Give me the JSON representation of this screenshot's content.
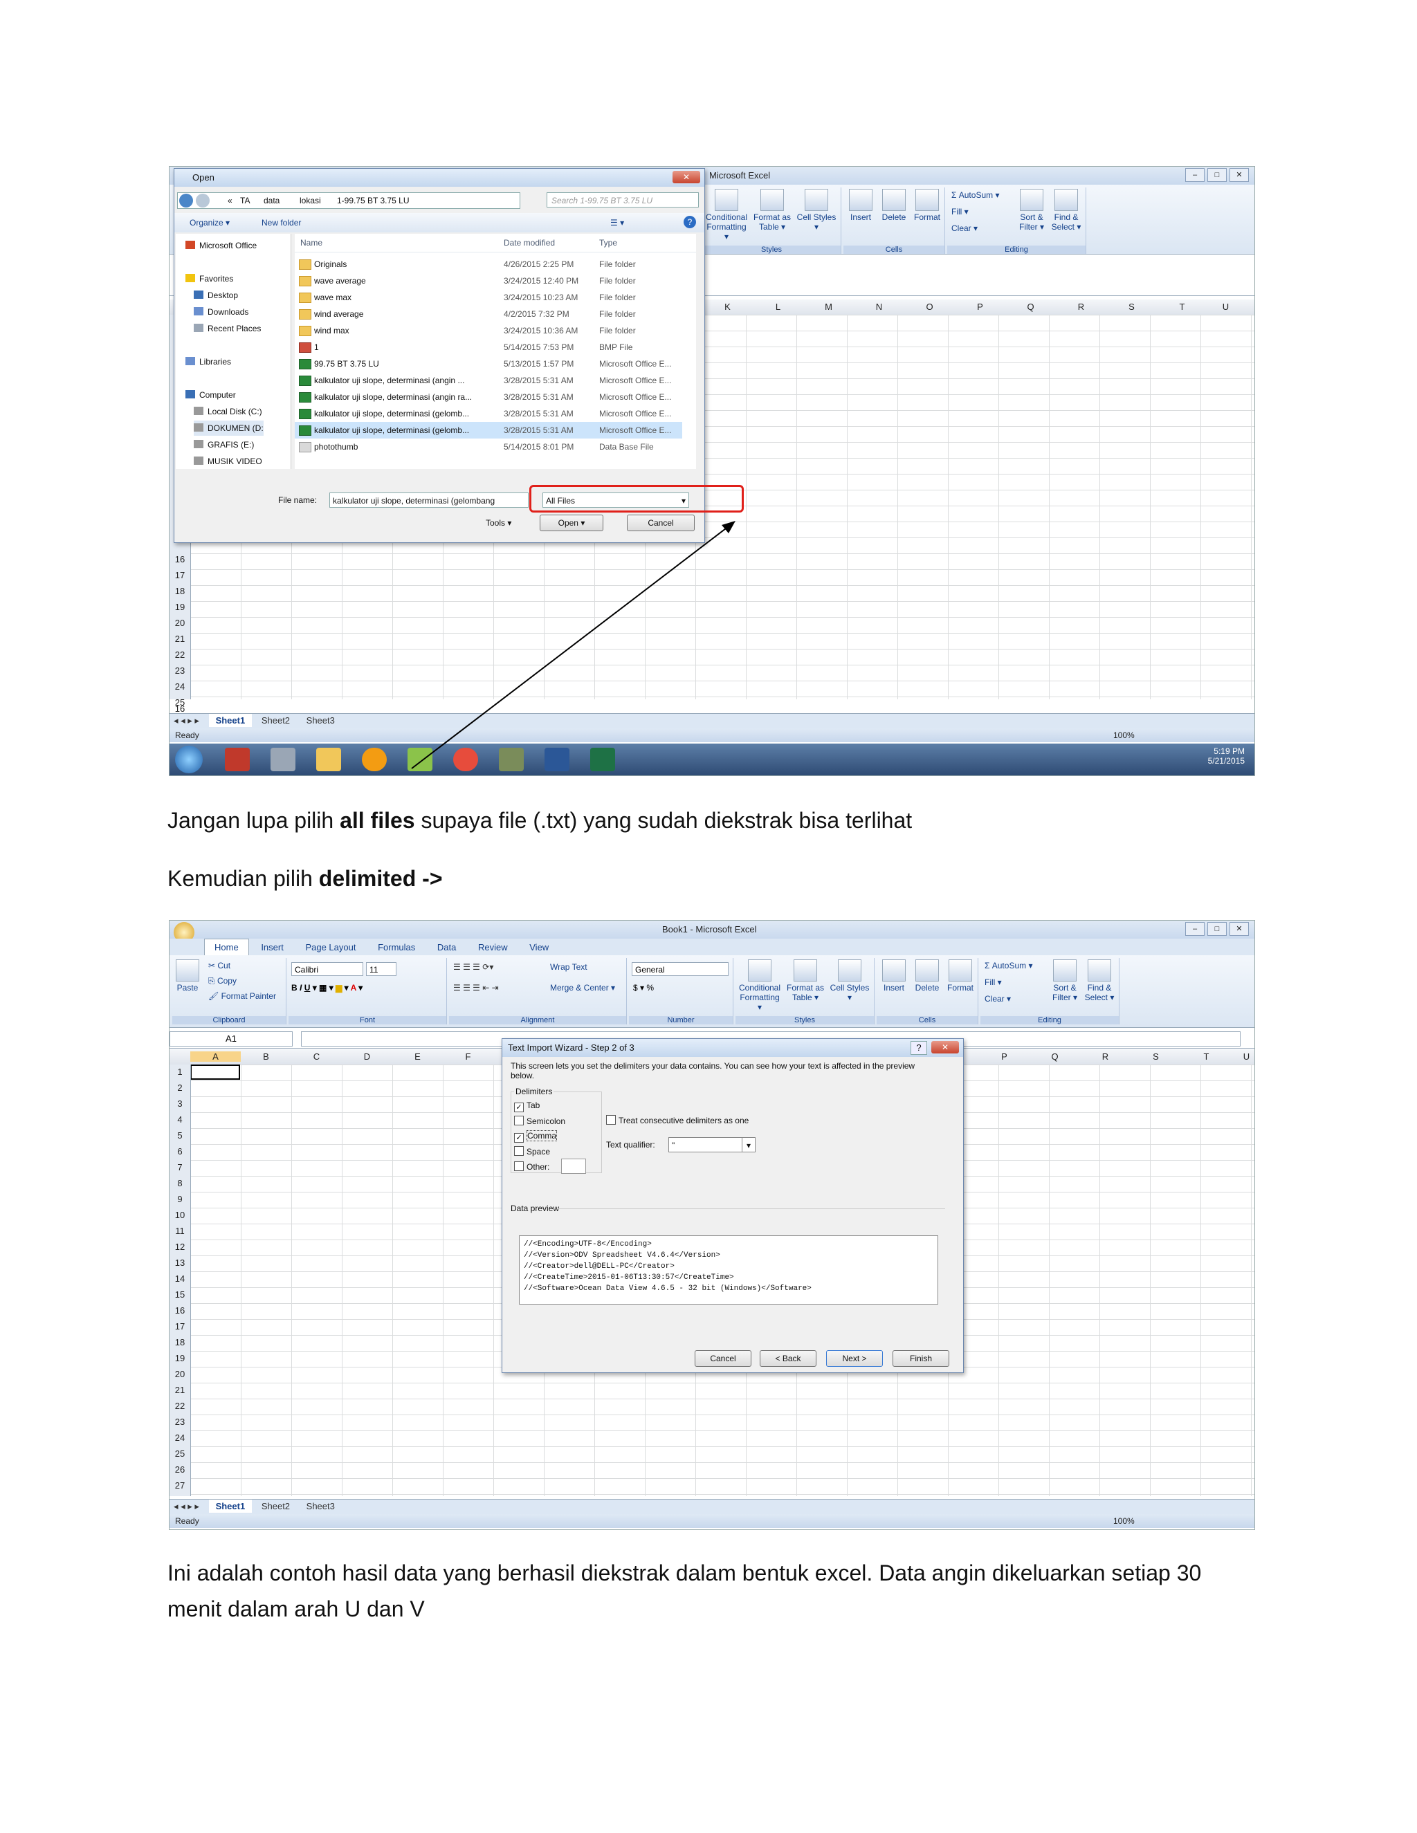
{
  "screenshot1": {
    "excel_title": "Microsoft Excel",
    "open_dialog": {
      "title": "Open",
      "path": [
        "TA",
        "data",
        "lokasi",
        "1-99.75 BT 3.75 LU"
      ],
      "path_prefix": "«",
      "search_placeholder": "Search 1-99.75 BT 3.75 LU",
      "organize": "Organize ▾",
      "new_folder": "New folder",
      "nav": [
        "Microsoft Office",
        "Favorites",
        "Desktop",
        "Downloads",
        "Recent Places",
        "Libraries",
        "Computer",
        "Local Disk (C:)",
        "DOKUMEN (D:",
        "GRAFIS (E:)",
        "MUSIK VIDEO"
      ],
      "columns": {
        "name": "Name",
        "date": "Date modified",
        "type": "Type"
      },
      "files": [
        {
          "name": "Originals",
          "date": "4/26/2015 2:25 PM",
          "type": "File folder",
          "icon": "folder"
        },
        {
          "name": "wave average",
          "date": "3/24/2015 12:40 PM",
          "type": "File folder",
          "icon": "folder"
        },
        {
          "name": "wave max",
          "date": "3/24/2015 10:23 AM",
          "type": "File folder",
          "icon": "folder"
        },
        {
          "name": "wind average",
          "date": "4/2/2015 7:32 PM",
          "type": "File folder",
          "icon": "folder"
        },
        {
          "name": "wind max",
          "date": "3/24/2015 10:36 AM",
          "type": "File folder",
          "icon": "folder"
        },
        {
          "name": "1",
          "date": "5/14/2015 7:53 PM",
          "type": "BMP File",
          "icon": "bmp"
        },
        {
          "name": "99.75 BT 3.75 LU",
          "date": "5/13/2015 1:57 PM",
          "type": "Microsoft Office E...",
          "icon": "xls"
        },
        {
          "name": "kalkulator uji slope, determinasi (angin ...",
          "date": "3/28/2015 5:31 AM",
          "type": "Microsoft Office E...",
          "icon": "xls"
        },
        {
          "name": "kalkulator uji slope, determinasi (angin ra...",
          "date": "3/28/2015 5:31 AM",
          "type": "Microsoft Office E...",
          "icon": "xls"
        },
        {
          "name": "kalkulator uji slope, determinasi (gelomb...",
          "date": "3/28/2015 5:31 AM",
          "type": "Microsoft Office E...",
          "icon": "xls"
        },
        {
          "name": "kalkulator uji slope, determinasi (gelomb...",
          "date": "3/28/2015 5:31 AM",
          "type": "Microsoft Office E...",
          "icon": "xls",
          "selected": true
        },
        {
          "name": "photothumb",
          "date": "5/14/2015 8:01 PM",
          "type": "Data Base File",
          "icon": "db"
        }
      ],
      "file_name_label": "File name:",
      "file_name_value": "kalkulator uji slope, determinasi (gelombang",
      "filter_value": "All Files",
      "tools": "Tools",
      "open": "Open",
      "cancel": "Cancel"
    },
    "ribbon": {
      "styles": [
        "Conditional Formatting ▾",
        "Format as Table ▾",
        "Cell Styles ▾"
      ],
      "styles_label": "Styles",
      "cells": [
        "Insert",
        "Delete",
        "Format"
      ],
      "cells_label": "Cells",
      "editing": [
        "Σ AutoSum ▾",
        "Fill ▾",
        "Clear ▾",
        "Sort & Filter ▾",
        "Find & Select ▾"
      ],
      "editing_label": "Editing"
    },
    "columns": [
      "K",
      "L",
      "M",
      "N",
      "O",
      "P",
      "Q",
      "R",
      "S",
      "T",
      "U"
    ],
    "rows": [
      "16",
      "17",
      "18",
      "19",
      "20",
      "21",
      "22",
      "23",
      "24",
      "25"
    ],
    "sheets": [
      "Sheet1",
      "Sheet2",
      "Sheet3"
    ],
    "status": "Ready",
    "zoom": "100%",
    "clock_time": "5:19 PM",
    "clock_date": "5/21/2015"
  },
  "caption1": {
    "pre": "Jangan lupa pilih ",
    "bold": "all files",
    "post": " supaya file (.txt) yang  sudah diekstrak bisa terlihat"
  },
  "caption2": {
    "pre": "Kemudian pilih ",
    "bold": "delimited ->"
  },
  "screenshot2": {
    "title": "Book1 - Microsoft Excel",
    "tabs": [
      "Home",
      "Insert",
      "Page Layout",
      "Formulas",
      "Data",
      "Review",
      "View"
    ],
    "clipboard": {
      "paste": "Paste",
      "cut": "Cut",
      "copy": "Copy",
      "painter": "Format Painter",
      "label": "Clipboard"
    },
    "font": {
      "name": "Calibri",
      "size": "11",
      "label": "Font"
    },
    "alignment": {
      "wrap": "Wrap Text",
      "merge": "Merge & Center ▾",
      "label": "Alignment"
    },
    "number": {
      "format": "General",
      "currency": "$ ▾ %",
      "label": "Number"
    },
    "ribbon": {
      "styles": [
        "Conditional Formatting ▾",
        "Format as Table ▾",
        "Cell Styles ▾"
      ],
      "styles_label": "Styles",
      "cells": [
        "Insert",
        "Delete",
        "Format"
      ],
      "cells_label": "Cells",
      "editing": [
        "Σ AutoSum ▾",
        "Fill ▾",
        "Clear ▾",
        "Sort & Filter ▾",
        "Find & Select ▾"
      ],
      "editing_label": "Editing"
    },
    "name_box": "A1",
    "columns": [
      "A",
      "B",
      "C",
      "D",
      "E",
      "F",
      "P",
      "Q",
      "R",
      "S",
      "T",
      "U"
    ],
    "rows": [
      "1",
      "2",
      "3",
      "4",
      "5",
      "6",
      "7",
      "8",
      "9",
      "10",
      "11",
      "12",
      "13",
      "14",
      "15",
      "16",
      "17",
      "18",
      "19",
      "20",
      "21",
      "22",
      "23",
      "24",
      "25",
      "26",
      "27"
    ],
    "wizard": {
      "title": "Text Import Wizard - Step 2 of 3",
      "intro": "This screen lets you set the delimiters your data contains.  You can see how your text is affected in the preview below.",
      "delimiters_label": "Delimiters",
      "options": [
        {
          "label": "Tab",
          "checked": true
        },
        {
          "label": "Semicolon",
          "checked": false
        },
        {
          "label": "Comma",
          "checked": true
        },
        {
          "label": "Space",
          "checked": false
        },
        {
          "label": "Other:",
          "checked": false
        }
      ],
      "consecutive": "Treat consecutive delimiters as one",
      "qualifier_label": "Text qualifier:",
      "qualifier_value": "\"",
      "preview_label": "Data preview",
      "preview_lines": "//<Encoding>UTF-8</Encoding>\n//<Version>ODV Spreadsheet V4.6.4</Version>\n//<Creator>dell@DELL-PC</Creator>\n//<CreateTime>2015-01-06T13:30:57</CreateTime>\n//<Software>Ocean Data View 4.6.5 - 32 bit (Windows)</Software>",
      "buttons": [
        "Cancel",
        "< Back",
        "Next >",
        "Finish"
      ]
    },
    "sheets": [
      "Sheet1",
      "Sheet2",
      "Sheet3"
    ],
    "status": "Ready",
    "zoom": "100%"
  },
  "caption3": "Ini adalah contoh hasil data yang berhasil diekstrak dalam bentuk excel. Data angin dikeluarkan setiap 30 menit dalam arah U dan V"
}
